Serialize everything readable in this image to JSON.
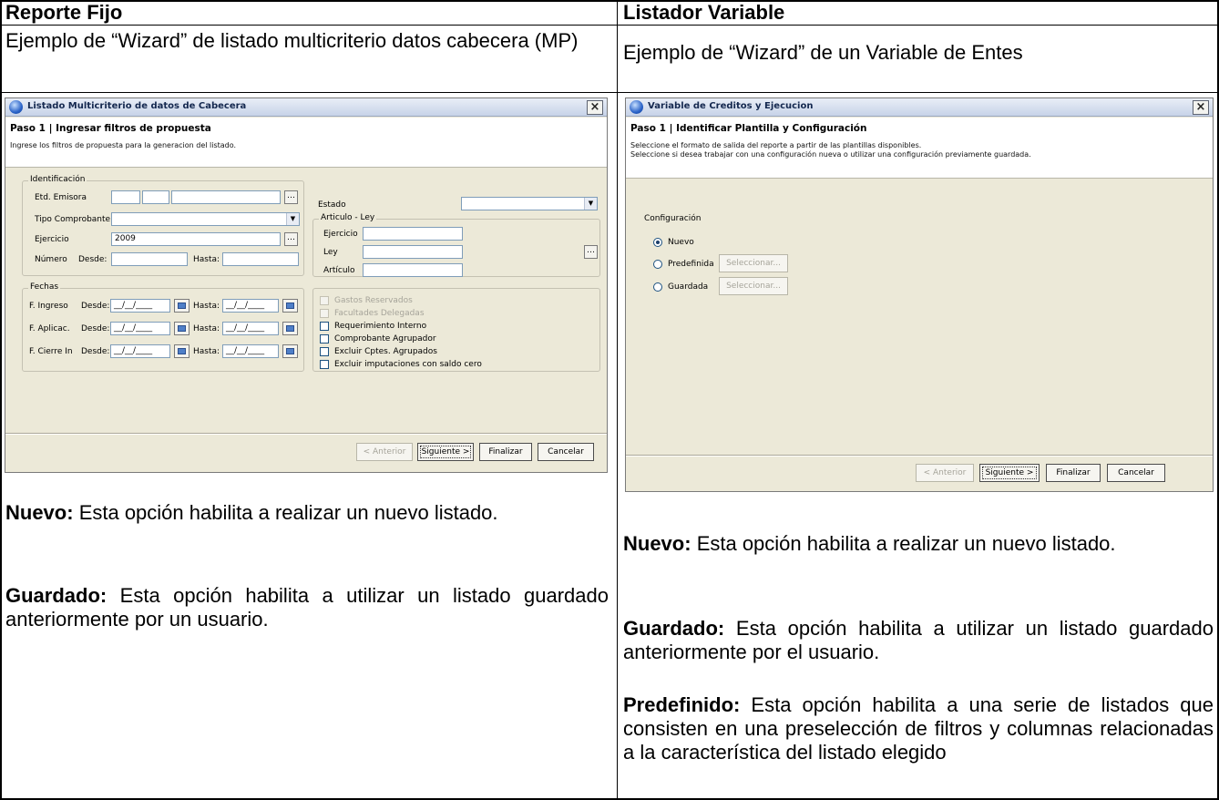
{
  "left": {
    "header": "Reporte Fijo",
    "subheader": "Ejemplo de “Wizard” de listado multicriterio datos cabecera (MP)",
    "dialog": {
      "title": "Listado Multicriterio de datos de Cabecera",
      "step": "Paso 1 | Ingresar filtros de propuesta",
      "instruction": "Ingrese los filtros de propuesta para la generacion del listado.",
      "identificacion": {
        "group": "Identificación",
        "etd_emisora": "Etd. Emisora",
        "tipo_comprobante": "Tipo Comprobante",
        "ejercicio": "Ejercicio",
        "ejercicio_value": "2009",
        "numero": "Número",
        "desde": "Desde:",
        "hasta": "Hasta:"
      },
      "estado": "Estado",
      "articulo_ley": {
        "group": "Articulo - Ley",
        "ejercicio": "Ejercicio",
        "ley": "Ley",
        "articulo": "Artículo"
      },
      "fechas": {
        "group": "Fechas",
        "ingreso": "F. Ingreso",
        "aplicac": "F. Aplicac.",
        "cierre": "F. Cierre In",
        "desde": "Desde:",
        "hasta": "Hasta:",
        "date_placeholder": "__/__/____"
      },
      "checks": {
        "gastos": "Gastos Reservados",
        "facultades": "Facultades Delegadas",
        "requerimiento": "Requerimiento Interno",
        "agrupador": "Comprobante Agrupador",
        "excluir_cptes": "Excluir Cptes. Agrupados",
        "excluir_imput": "Excluir imputaciones con saldo cero"
      },
      "buttons": {
        "anterior": "< Anterior",
        "siguiente": "Siguiente >",
        "finalizar": "Finalizar",
        "cancelar": "Cancelar"
      }
    },
    "desc": {
      "nuevo_term": "Nuevo:",
      "nuevo_text": "Esta opción habilita a realizar un nuevo listado.",
      "guardado_term": "Guardado:",
      "guardado_text": "Esta opción habilita a utilizar un listado guardado anteriormente por un usuario."
    }
  },
  "right": {
    "header": "Listador Variable",
    "subheader": "Ejemplo de “Wizard” de un Variable de Entes",
    "dialog": {
      "title": "Variable de Creditos y Ejecucion",
      "step": "Paso 1 | Identificar Plantilla y Configuración",
      "instruction1": "Seleccione el formato de salida del reporte a partir de las plantillas disponibles.",
      "instruction2": "Seleccione si desea trabajar con una configuración nueva o utilizar una configuración previamente guardada.",
      "config_label": "Configuración",
      "opt_nuevo": "Nuevo",
      "opt_predefinida": "Predefinida",
      "opt_guardada": "Guardada",
      "seleccionar": "Seleccionar...",
      "buttons": {
        "anterior": "< Anterior",
        "siguiente": "Siguiente >",
        "finalizar": "Finalizar",
        "cancelar": "Cancelar"
      }
    },
    "desc": {
      "nuevo_term": "Nuevo:",
      "nuevo_text": "Esta opción habilita a realizar un nuevo listado.",
      "guardado_term": "Guardado:",
      "guardado_text": "Esta opción habilita a utilizar un listado guardado anteriormente por el usuario.",
      "predef_term": "Predefinido:",
      "predef_text": "Esta opción habilita a una serie de listados que consisten en una preselección de filtros y columnas relacionadas a la característica del listado elegido"
    }
  }
}
